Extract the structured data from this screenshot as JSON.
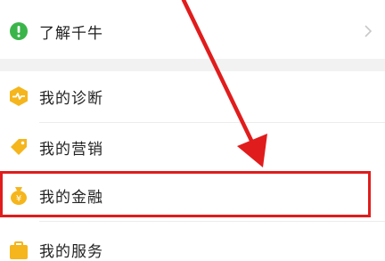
{
  "menu": {
    "items": [
      {
        "label": "了解千牛",
        "icon": "info-circle-icon",
        "color": "#3bb54a"
      },
      {
        "label": "我的诊断",
        "icon": "diagnosis-hexagon-icon",
        "color": "#f5b51c"
      },
      {
        "label": "我的营销",
        "icon": "tag-icon",
        "color": "#f5b51c"
      },
      {
        "label": "我的金融",
        "icon": "money-bag-icon",
        "color": "#f5b51c"
      },
      {
        "label": "我的服务",
        "icon": "briefcase-icon",
        "color": "#f5b51c"
      }
    ]
  },
  "annotation": {
    "highlight_color": "#e11c1c",
    "highlighted_item": "我的金融"
  }
}
